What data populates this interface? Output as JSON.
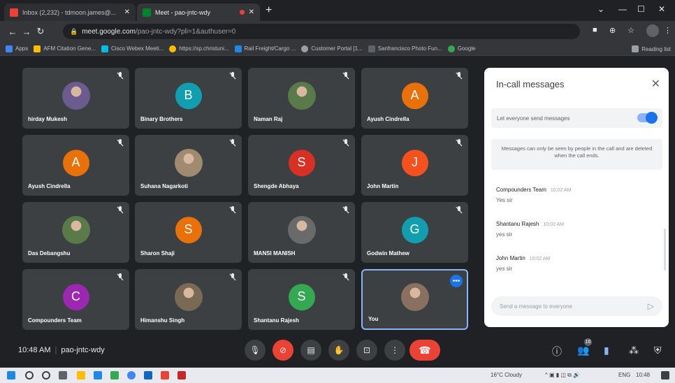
{
  "browser": {
    "tabs": [
      {
        "title": "Inbox (2,232) - tdmoon.james@...",
        "active": false
      },
      {
        "title": "Meet - pao-jntc-wdy",
        "active": true
      }
    ],
    "url_host": "meet.google.com",
    "url_path": "/pao-jntc-wdy?pli=1&authuser=0",
    "bookmarks": [
      "Apps",
      "AFM Citation Gene...",
      "Cisco Webex Meeti...",
      "https://sp.christuni...",
      "Rail Freight/Cargo ...",
      "Customer Portal [1...",
      "Sanfrancisco Photo Fun...",
      "Google"
    ],
    "reading_list": "Reading list"
  },
  "participants": [
    {
      "name": "hirday Mukesh",
      "initial": "",
      "color": ""
    },
    {
      "name": "Binary Brothers",
      "initial": "B",
      "color": "#129eaf"
    },
    {
      "name": "Naman Raj",
      "initial": "",
      "color": ""
    },
    {
      "name": "Ayush Cindrella",
      "initial": "A",
      "color": "#e8710a"
    },
    {
      "name": "Ayush Cindrella",
      "initial": "A",
      "color": "#e8710a"
    },
    {
      "name": "Suhana Nagarkoti",
      "initial": "",
      "color": ""
    },
    {
      "name": "Shengde Abhaya",
      "initial": "S",
      "color": "#d93025"
    },
    {
      "name": "John Martin",
      "initial": "J",
      "color": "#f4511e"
    },
    {
      "name": "Das Debangshu",
      "initial": "",
      "color": ""
    },
    {
      "name": "Sharon Shaji",
      "initial": "S",
      "color": "#e8710a"
    },
    {
      "name": "MANSI MANISH",
      "initial": "",
      "color": ""
    },
    {
      "name": "Godwin Mathew",
      "initial": "G",
      "color": "#129eaf"
    },
    {
      "name": "Compounders Team",
      "initial": "C",
      "color": "#9c27b0"
    },
    {
      "name": "Himanshu Singh",
      "initial": "",
      "color": ""
    },
    {
      "name": "Shantanu Rajesh",
      "initial": "S",
      "color": "#34a853"
    },
    {
      "name": "You",
      "initial": "",
      "color": ""
    }
  ],
  "chat": {
    "title": "In-call messages",
    "toggle_label": "Let everyone send messages",
    "notice": "Messages can only be seen by people in the call and are deleted when the call ends.",
    "messages": [
      {
        "sender": "Compounders Team",
        "time": "10:02 AM",
        "text": "Yes sir"
      },
      {
        "sender": "Shantanu Rajesh",
        "time": "10:02 AM",
        "text": "yes sir"
      },
      {
        "sender": "John Martin",
        "time": "10:02 AM",
        "text": "yes sir"
      }
    ],
    "input_placeholder": "Send a message to everyone"
  },
  "meeting": {
    "time": "10:48 AM",
    "code": "pao-jntc-wdy",
    "people_count": "16"
  },
  "taskbar": {
    "weather": "16°C  Cloudy",
    "lang": "ENG",
    "clock": "10:48"
  },
  "colors": {
    "accent": "#1a73e8",
    "hangup": "#ea4335",
    "bg": "#202124",
    "tile": "#3c4043"
  }
}
